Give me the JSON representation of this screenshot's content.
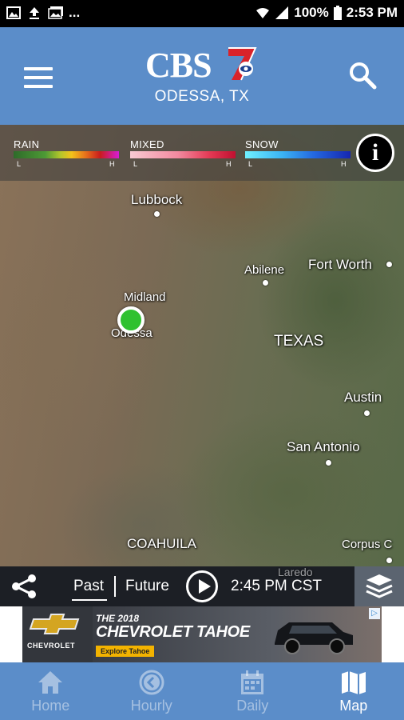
{
  "status_bar": {
    "battery": "100%",
    "time": "2:53 PM",
    "notification_more": "..."
  },
  "header": {
    "logo_text": "CBS",
    "logo_number": "7",
    "location": "ODESSA, TX"
  },
  "legend": {
    "rain": {
      "label": "RAIN",
      "low": "L",
      "high": "H"
    },
    "mixed": {
      "label": "MIXED",
      "low": "L",
      "high": "H"
    },
    "snow": {
      "label": "SNOW",
      "low": "L",
      "high": "H"
    },
    "info_label": "i"
  },
  "map": {
    "places": {
      "lubbock": "Lubbock",
      "abilene": "Abilene",
      "fort_worth": "Fort Worth",
      "midland": "Midland",
      "odessa": "Odessa",
      "texas": "TEXAS",
      "austin": "Austin",
      "san_antonio": "San Antonio",
      "coahuila": "COAHUILA",
      "corpus": "Corpus C",
      "laredo": "Laredo"
    }
  },
  "playback": {
    "past": "Past",
    "future": "Future",
    "time": "2:45 PM CST"
  },
  "ad": {
    "brand": "CHEVROLET",
    "headline_small": "THE 2018",
    "headline_large": "CHEVROLET TAHOE",
    "cta": "Explore Tahoe"
  },
  "nav": {
    "items": [
      {
        "label": "Home",
        "icon": "home-icon"
      },
      {
        "label": "Hourly",
        "icon": "clock-icon"
      },
      {
        "label": "Daily",
        "icon": "calendar-icon"
      },
      {
        "label": "Map",
        "icon": "map-icon",
        "active": true
      }
    ]
  },
  "colors": {
    "brand_blue": "#5b8dc9",
    "marker_green": "#2fc12f"
  }
}
